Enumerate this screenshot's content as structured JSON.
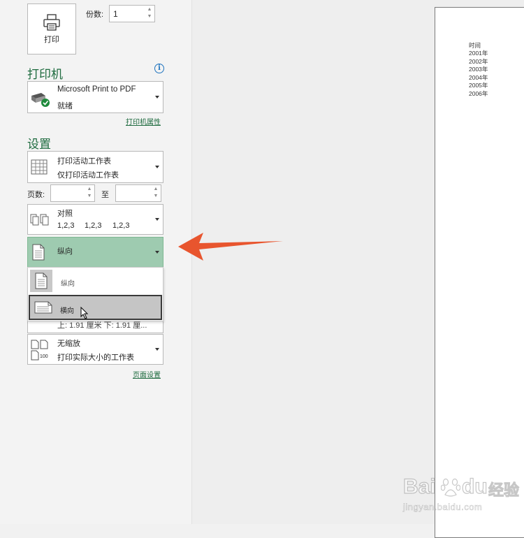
{
  "print": {
    "button_label": "打印",
    "copies_label": "份数:",
    "copies_value": "1"
  },
  "printer": {
    "section_title": "打印机",
    "name": "Microsoft Print to PDF",
    "status": "就绪",
    "properties_link": "打印机属性"
  },
  "settings": {
    "section_title": "设置",
    "scope": {
      "line1": "打印活动工作表",
      "line2": "仅打印活动工作表"
    },
    "pages_label": "页数:",
    "pages_to_label": "至",
    "pages_from": "",
    "pages_to": "",
    "collate": {
      "line1": "对照",
      "line2_parts": [
        "1,2,3",
        "1,2,3",
        "1,2,3"
      ]
    },
    "orientation": {
      "selected": "纵向",
      "options": [
        "纵向",
        "横向"
      ],
      "hovered": "横向"
    },
    "margins_partial": "上: 1.91 厘米 下: 1.91 厘...",
    "scaling": {
      "line1": "无缩放",
      "line2": "打印实际大小的工作表",
      "icon_text": "100"
    },
    "page_setup_link": "页面设置"
  },
  "preview": {
    "lines": [
      "时间",
      "2001年",
      "2002年",
      "2003年",
      "2004年",
      "2005年",
      "2006年"
    ]
  },
  "watermark": {
    "brand": "Bai",
    "brand2": "du",
    "cn": "经验",
    "url": "jingyan.baidu.com"
  },
  "colors": {
    "accent": "#1e6b3f",
    "selected_fill": "#9ecbb0",
    "arrow": "#e8552e"
  }
}
